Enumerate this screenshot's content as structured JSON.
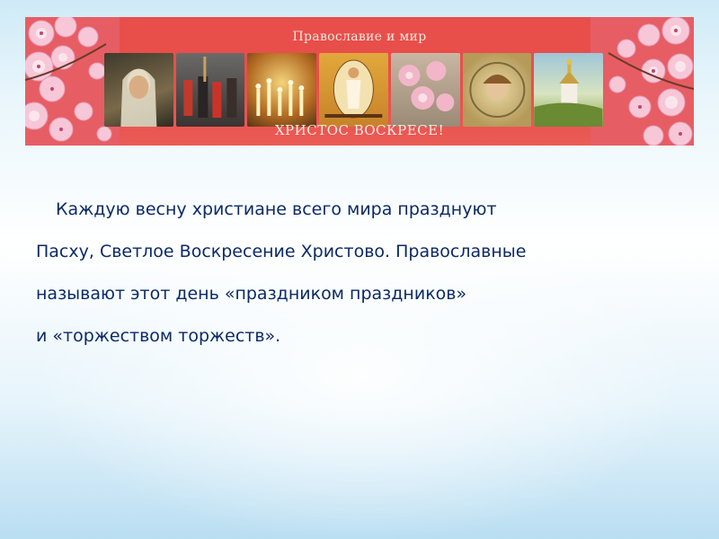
{
  "banner": {
    "title": "Православие и мир",
    "caption": "ХРИСТОС ВОСКРЕСЕ!",
    "panels": [
      "portrait",
      "procession",
      "candles",
      "resurrection-icon",
      "flowers",
      "child-portrait",
      "church-landscape"
    ]
  },
  "text": {
    "lines": [
      "Каждую весну христиане всего мира празднуют",
      "Пасху, Светлое Воскресение Христово. Православные",
      "называют этот день «праздником праздников»",
      "и «торжеством торжеств»."
    ]
  },
  "colors": {
    "banner_red": "#e84f4a",
    "text_blue": "#0b2a66"
  }
}
